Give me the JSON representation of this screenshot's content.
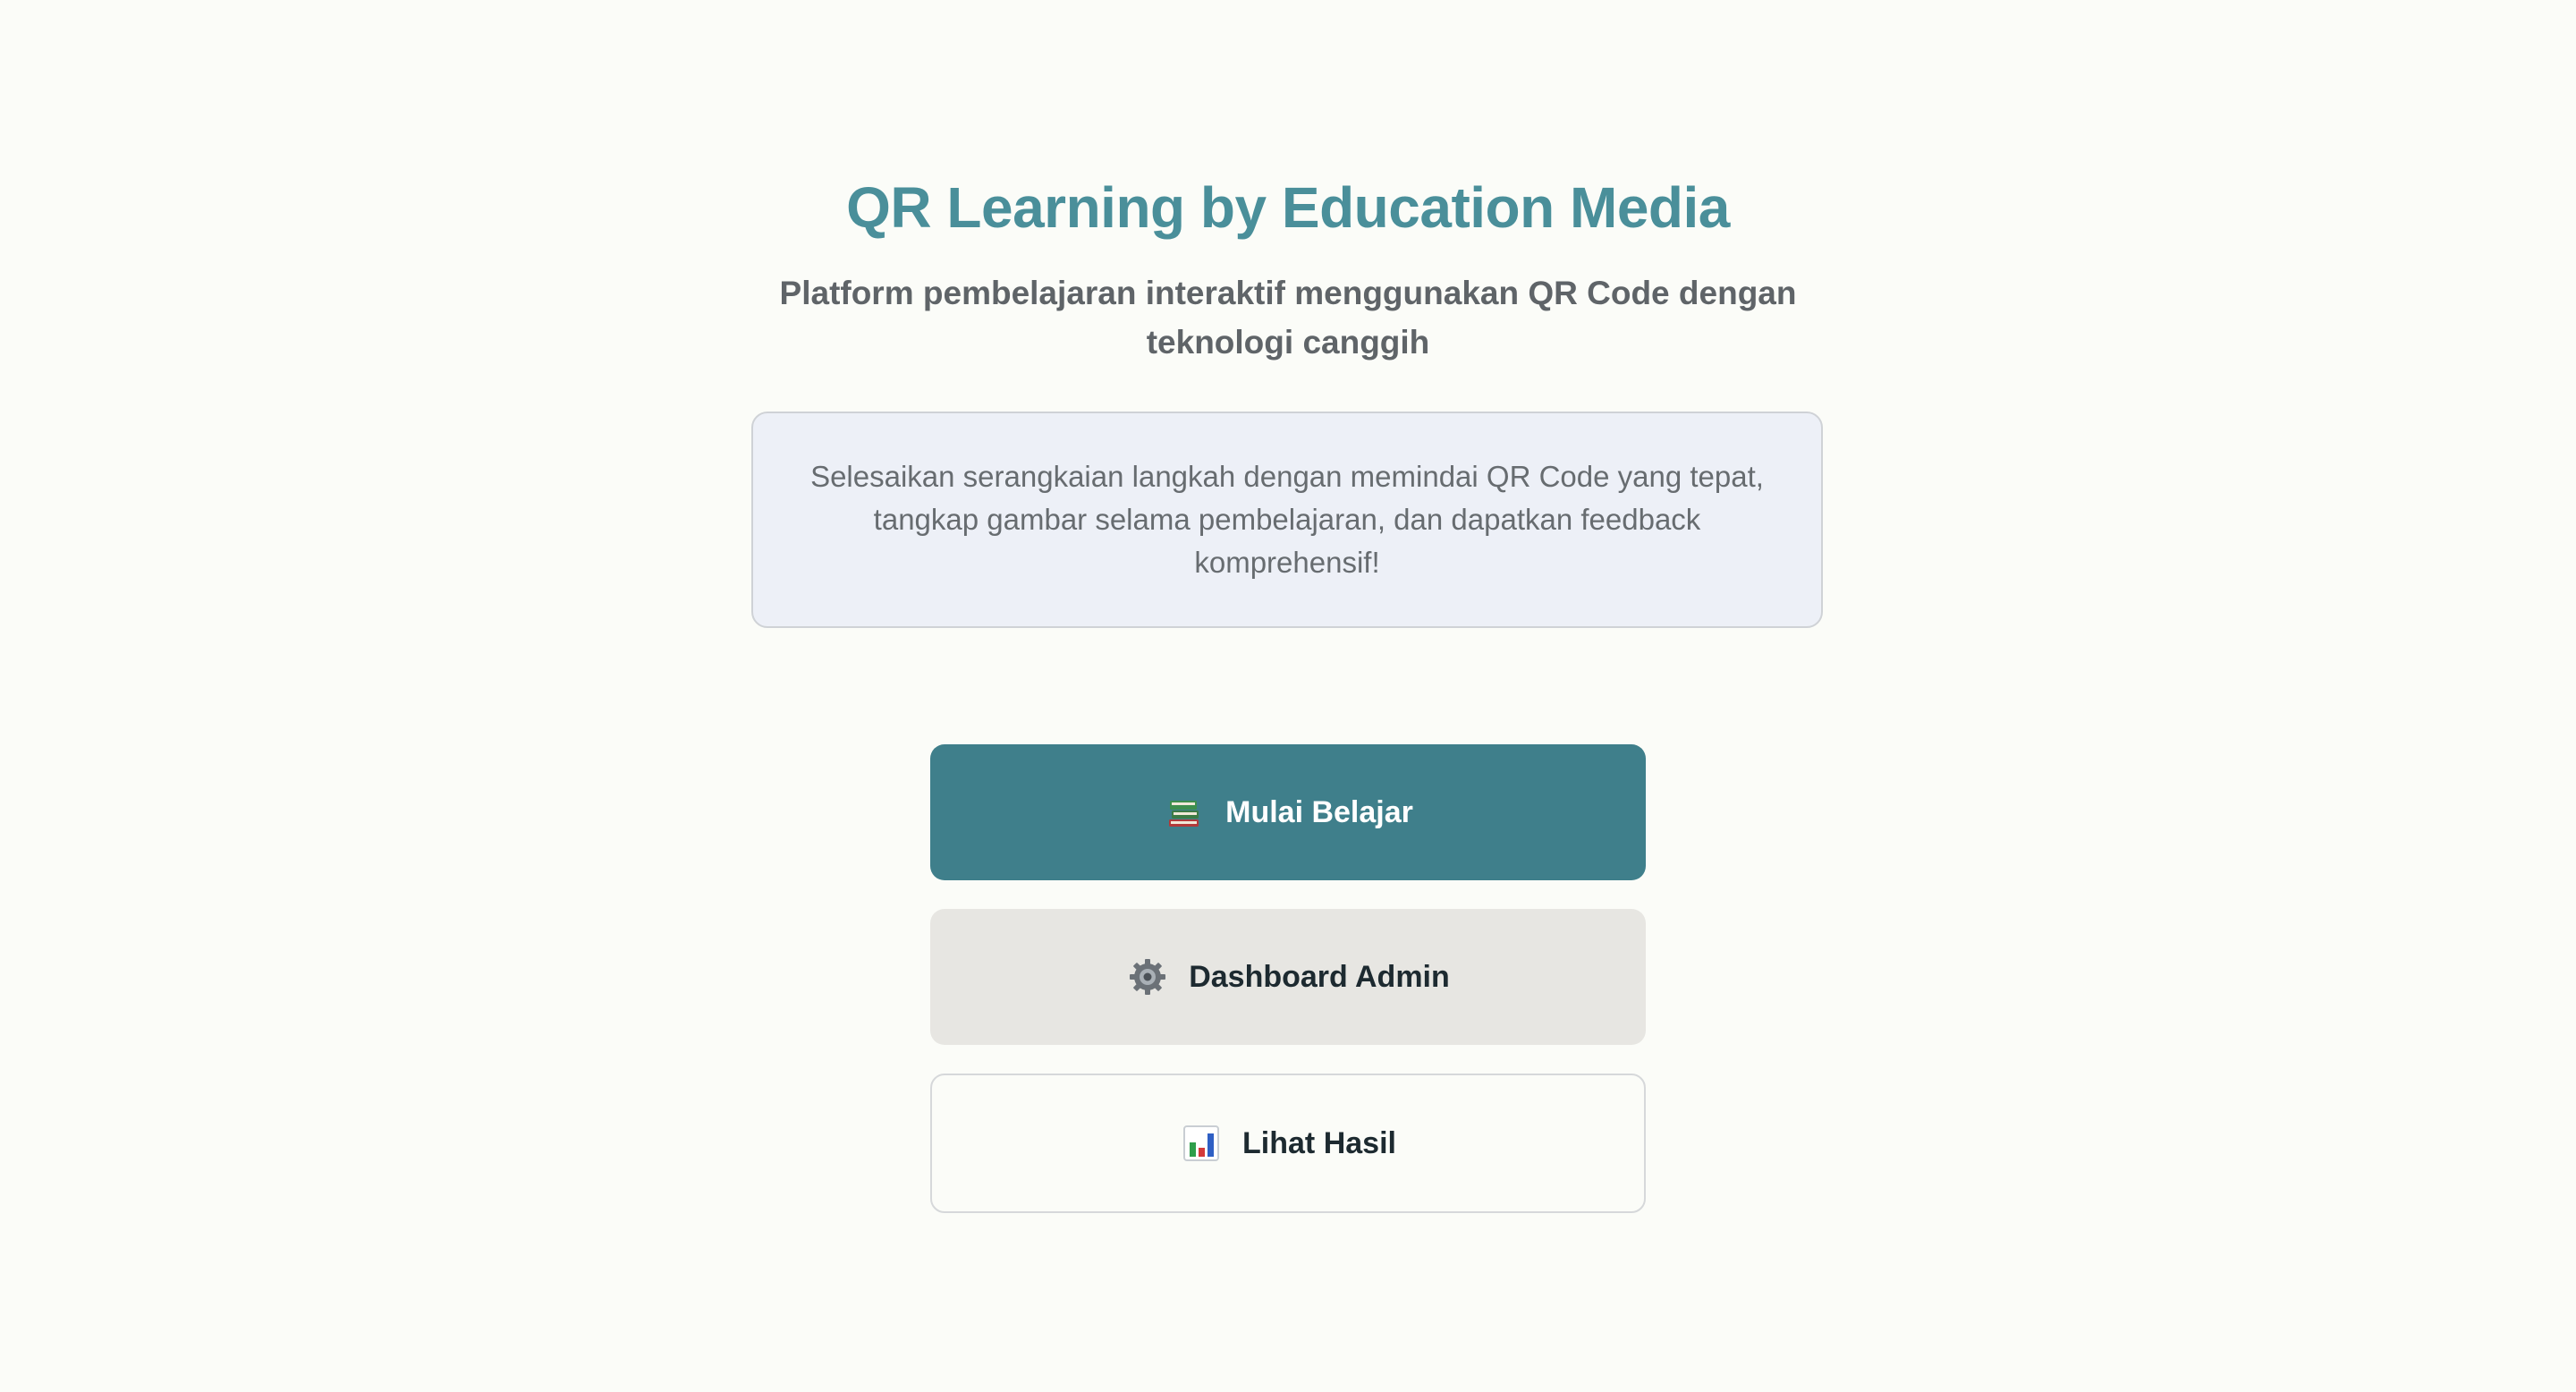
{
  "hero": {
    "title": "QR Learning by Education Media",
    "subtitle": "Platform pembelajaran interaktif menggunakan QR Code dengan teknologi canggih",
    "info": "Selesaikan serangkaian langkah dengan memindai QR Code yang tepat, tangkap gambar selama pembelajaran, dan dapatkan feedback komprehensif!"
  },
  "actions": {
    "start": {
      "label": "Mulai Belajar",
      "icon": "books-icon"
    },
    "admin": {
      "label": "Dashboard Admin",
      "icon": "gear-icon"
    },
    "results": {
      "label": "Lihat Hasil",
      "icon": "bar-chart-icon"
    }
  },
  "colors": {
    "background": "#fbfcf8",
    "title": "#4a8f9a",
    "primary_button": "#3f7f8b",
    "secondary_button": "#e7e6e2",
    "info_box": "#edf0f7"
  }
}
